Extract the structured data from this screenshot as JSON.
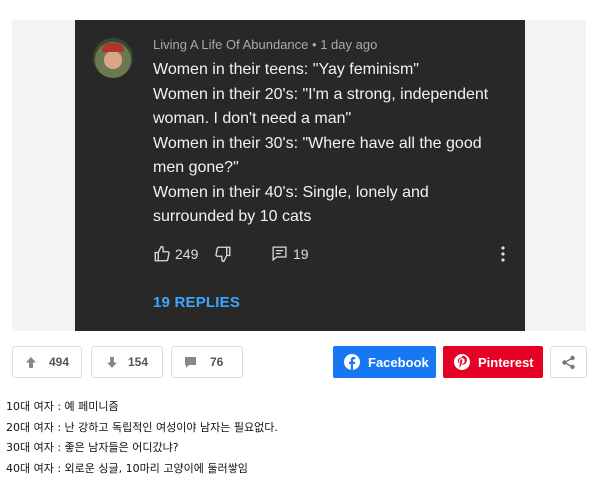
{
  "youtube_comment": {
    "author": "Living A Life Of Abundance",
    "separator": "•",
    "time": "1 day ago",
    "lines": [
      "Women in their teens: \"Yay feminism\"",
      "Women in their 20's: \"I'm a strong, independent",
      "woman. I don't need a man\"",
      "Women in their 30's: \"Where have all the good",
      "men gone?\"",
      "Women in their 40's: Single, lonely and",
      "surrounded by 10 cats"
    ],
    "likes": "249",
    "reply_count": "19",
    "replies_link": "19 REPLIES"
  },
  "votes": {
    "up": "494",
    "down": "154",
    "comments": "76"
  },
  "share": {
    "facebook": "Facebook",
    "pinterest": "Pinterest",
    "facebook_color": "#1877f2",
    "pinterest_color": "#e60023"
  },
  "post_text": [
    "10대 여자 : 예 페미니즘",
    "20대 여자 : 난 강하고 독립적인 여성이야 남자는 필요없다.",
    "30대 여자 : 좋은 남자들은 어디갔냐?",
    "40대 여자 : 외로운 싱글, 10마리 고양이에 둘러쌓임"
  ]
}
